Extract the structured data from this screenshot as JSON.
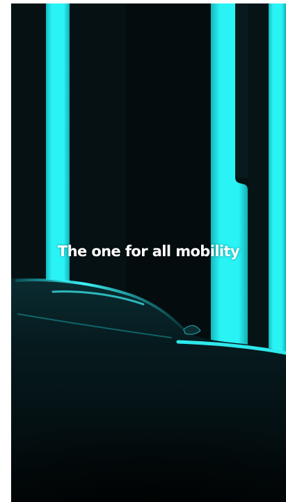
{
  "video": {
    "headline": "The one for all mobility",
    "accent_color": "#1fe6ea",
    "background_color": "#061113",
    "subject": "car-silhouette"
  }
}
